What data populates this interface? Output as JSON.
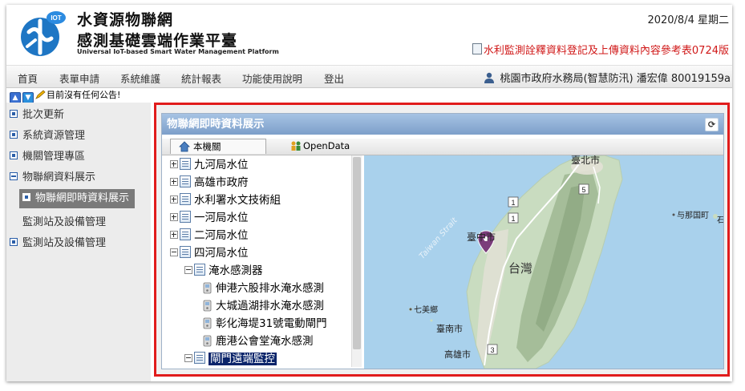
{
  "header": {
    "logo_badge": "IOT",
    "logo_char": "水",
    "title_line1": "水資源物聯網",
    "title_line2": "感測基礎雲端作業平臺",
    "subtitle": "Universal IoT-based Smart Water Management Platform",
    "date": "2020/8/4 星期二",
    "notice_link": "水利監測詮釋資料登記及上傳資料內容參考表0724版"
  },
  "nav": {
    "items": [
      "首頁",
      "表單申請",
      "系統維護",
      "統計報表",
      "功能使用說明",
      "登出"
    ],
    "user": "桃園市政府水務局(智慧防汛) 潘宏偉 80019159a"
  },
  "announcement": "目前沒有任何公告!",
  "sidebar": {
    "items": [
      "批次更新",
      "系統資源管理",
      "機關管理專區",
      "物聯網資料展示"
    ],
    "active": "物聯網即時資料展示",
    "sub": "監測站及設備管理",
    "last": "監測站及設備管理"
  },
  "panel": {
    "title": "物聯網即時資料展示",
    "tabs": [
      "本機關",
      "OpenData"
    ]
  },
  "tree": {
    "nodes": [
      "九河局水位",
      "高雄市政府",
      "水利署水文技術組",
      "一河局水位",
      "二河局水位",
      "四河局水位"
    ],
    "child_group": "淹水感測器",
    "devices": [
      "伸港六股排水淹水感測",
      "大城過湖排水淹水感測",
      "彰化海堤31號電動閘門",
      "鹿港公會堂淹水感測"
    ],
    "selected": "閘門遠端監控"
  },
  "map": {
    "labels": [
      "臺北市",
      "臺中市",
      "台灣",
      "Taiwan Strait",
      "七美鄉",
      "臺南市",
      "高雄市",
      "与那国町",
      "石"
    ],
    "road_shields": [
      "5",
      "1",
      "1",
      "3"
    ],
    "colors": {
      "sea": "#a9d1ec",
      "land": "#c9dcc0",
      "mountain": "#9fb792",
      "urban": "#e3e1d6",
      "marker": "#7b3d7b"
    }
  }
}
